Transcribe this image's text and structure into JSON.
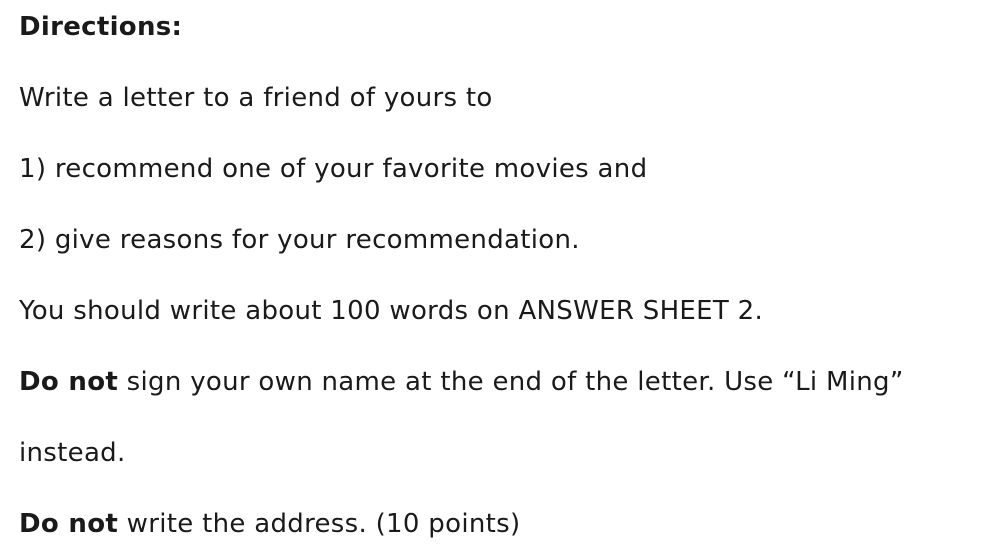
{
  "document": {
    "heading": "Directions:",
    "line1": "Write a letter to a friend of yours to",
    "line2": "1) recommend one of your favorite movies and",
    "line3": "2) give reasons for your recommendation.",
    "line4": "You should write about 100 words on ANSWER SHEET 2.",
    "line5_bold": "Do not",
    "line5_rest": " sign your own name at the end of the letter. Use “Li Ming”",
    "line6": "instead.",
    "line7_bold": "Do not",
    "line7_rest": " write the address. (10 points)"
  }
}
